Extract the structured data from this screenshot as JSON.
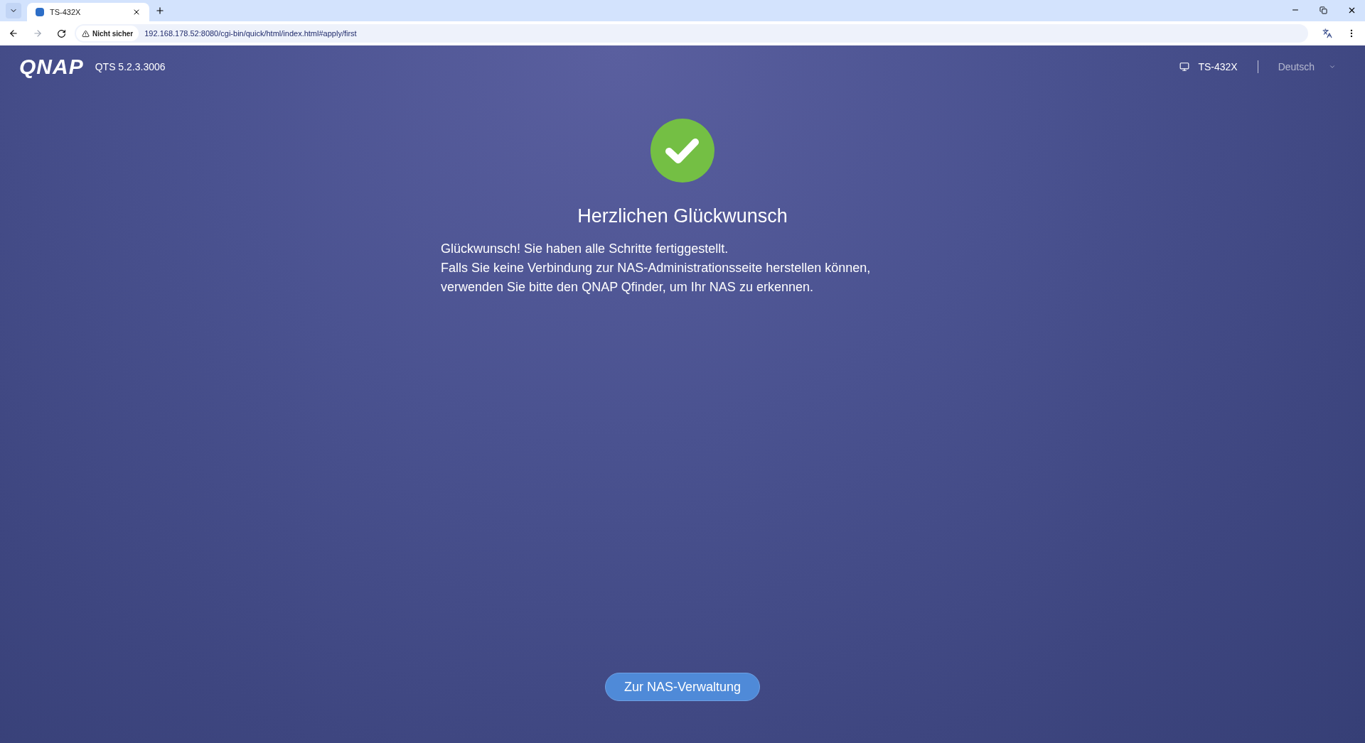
{
  "browser": {
    "tab_title": "TS-432X",
    "security_label": "Nicht sicher",
    "url": "192.168.178.52:8080/cgi-bin/quick/html/index.html#apply/first"
  },
  "header": {
    "logo": "QNAP",
    "version": "QTS 5.2.3.3006",
    "device": "TS-432X",
    "language": "Deutsch"
  },
  "content": {
    "title": "Herzlichen Glückwunsch",
    "lines": [
      "Glückwunsch! Sie haben alle Schritte fertiggestellt.",
      "Falls Sie keine Verbindung zur NAS-Administrationsseite herstellen können,",
      "verwenden Sie bitte den QNAP Qfinder, um Ihr NAS zu erkennen."
    ]
  },
  "button": "Zur NAS-Verwaltung"
}
